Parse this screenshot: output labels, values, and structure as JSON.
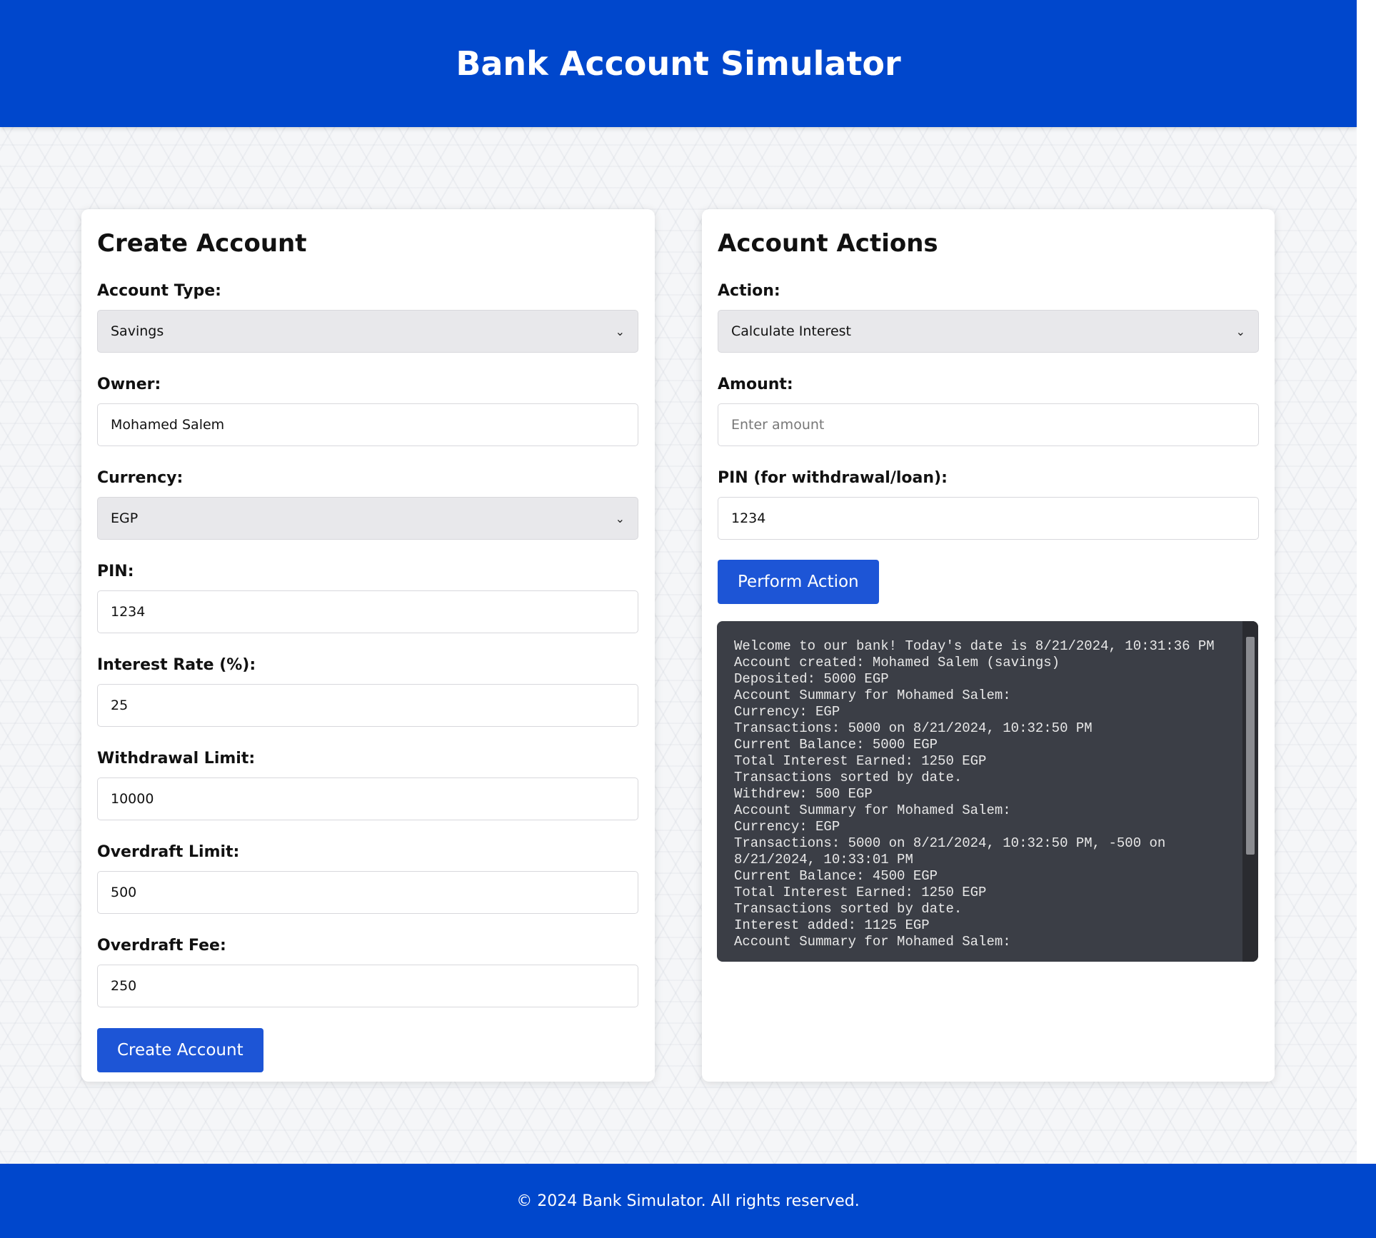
{
  "header": {
    "title": "Bank Account Simulator"
  },
  "create": {
    "title": "Create Account",
    "account_type": {
      "label": "Account Type:",
      "value": "Savings"
    },
    "owner": {
      "label": "Owner:",
      "value": "Mohamed Salem"
    },
    "currency": {
      "label": "Currency:",
      "value": "EGP"
    },
    "pin": {
      "label": "PIN:",
      "value": "1234"
    },
    "interest_rate": {
      "label": "Interest Rate (%):",
      "value": "25"
    },
    "withdrawal_limit": {
      "label": "Withdrawal Limit:",
      "value": "10000"
    },
    "overdraft_limit": {
      "label": "Overdraft Limit:",
      "value": "500"
    },
    "overdraft_fee": {
      "label": "Overdraft Fee:",
      "value": "250"
    },
    "button": "Create Account"
  },
  "actions": {
    "title": "Account Actions",
    "action": {
      "label": "Action:",
      "value": "Calculate Interest"
    },
    "amount": {
      "label": "Amount:",
      "placeholder": "Enter amount",
      "value": ""
    },
    "pin": {
      "label": "PIN (for withdrawal/loan):",
      "value": "1234"
    },
    "button": "Perform Action",
    "console_log": "Welcome to our bank! Today's date is 8/21/2024, 10:31:36 PM\nAccount created: Mohamed Salem (savings)\nDeposited: 5000 EGP\nAccount Summary for Mohamed Salem:\nCurrency: EGP\nTransactions: 5000 on 8/21/2024, 10:32:50 PM\nCurrent Balance: 5000 EGP\nTotal Interest Earned: 1250 EGP\nTransactions sorted by date.\nWithdrew: 500 EGP\nAccount Summary for Mohamed Salem:\nCurrency: EGP\nTransactions: 5000 on 8/21/2024, 10:32:50 PM, -500 on 8/21/2024, 10:33:01 PM\nCurrent Balance: 4500 EGP\nTotal Interest Earned: 1250 EGP\nTransactions sorted by date.\nInterest added: 1125 EGP\nAccount Summary for Mohamed Salem:"
  },
  "footer": {
    "text": "© 2024 Bank Simulator. All rights reserved."
  },
  "colors": {
    "brand": "#0047cc",
    "button": "#1d55d6",
    "console_bg": "#3b3e46"
  },
  "icons": {
    "select_arrow": "chevron-down-icon"
  }
}
